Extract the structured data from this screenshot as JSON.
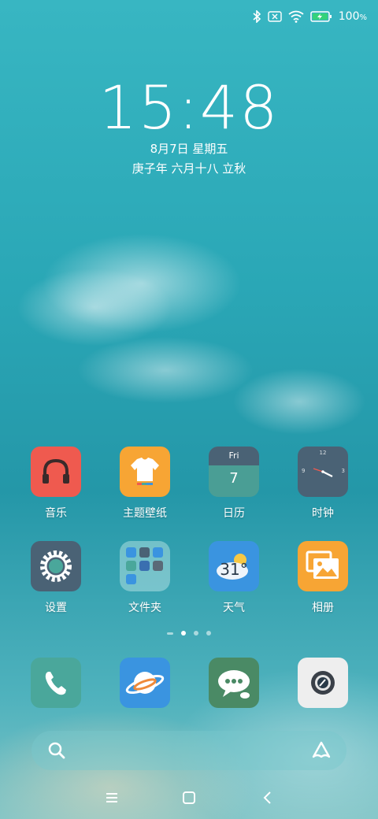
{
  "status": {
    "battery_text": "100",
    "battery_unit": "%",
    "icons": [
      "bluetooth-icon",
      "sim-x-icon",
      "wifi-icon",
      "battery-charging-icon"
    ]
  },
  "lockclock": {
    "time": "15:48",
    "date": "8月7日  星期五",
    "lunar": "庚子年 六月十八 立秋"
  },
  "apps": {
    "row1": [
      {
        "label": "音乐",
        "icon": "headphones-icon",
        "color": "#ef5a4f"
      },
      {
        "label": "主题壁纸",
        "icon": "tshirt-icon",
        "color": "#f7a534"
      },
      {
        "label": "日历",
        "icon": "calendar-icon",
        "color": "#4a9e95",
        "day_name": "Fri",
        "day_num": "7"
      },
      {
        "label": "时钟",
        "icon": "clock-icon",
        "color": "#4a6275",
        "clock_marks": [
          "12",
          "3",
          "9"
        ]
      }
    ],
    "row2": [
      {
        "label": "设置",
        "icon": "gear-icon",
        "color": "#4a6275"
      },
      {
        "label": "文件夹",
        "icon": "folder-icon",
        "color": "#7ec4c9"
      },
      {
        "label": "天气",
        "icon": "weather-icon",
        "color": "#3a94e0",
        "temp": "31°"
      },
      {
        "label": "相册",
        "icon": "gallery-icon",
        "color": "#f7a534"
      }
    ]
  },
  "dock": [
    {
      "icon": "phone-icon",
      "color": "#4aa79b"
    },
    {
      "icon": "browser-planet-icon",
      "color": "#3a94e0"
    },
    {
      "icon": "messages-icon",
      "color": "#4a8a65"
    },
    {
      "icon": "camera-icon",
      "color": "#eeeeee"
    }
  ]
}
